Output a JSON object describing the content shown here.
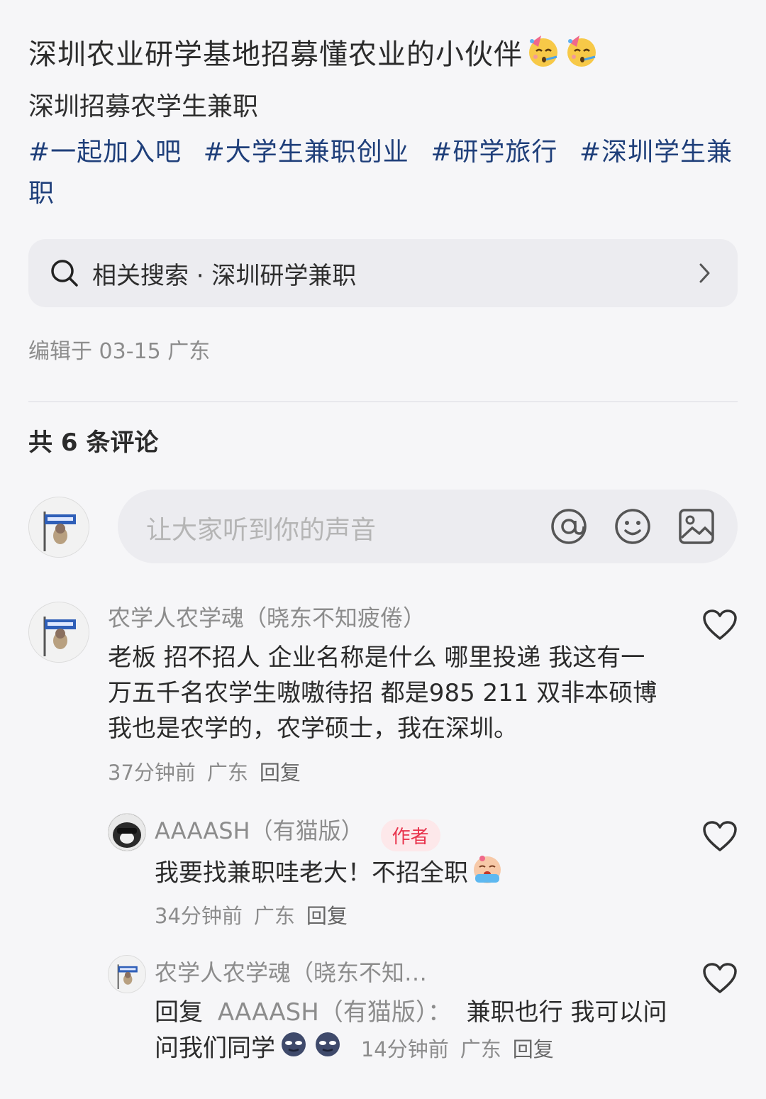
{
  "post": {
    "title": "深圳农业研学基地招募懂农业的小伙伴",
    "subtitle": "深圳招募农学生兼职",
    "tags": [
      "#一起加入吧",
      "#大学生兼职创业",
      "#研学旅行",
      "#深圳学生兼职"
    ],
    "related_search": "相关搜索 · 深圳研学兼职",
    "edited": "编辑于 03-15 广东",
    "title_emoji": "party-face-icon"
  },
  "comments_section": {
    "count_label": "共 6 条评论",
    "input_placeholder": "让大家听到你的声音"
  },
  "comments": [
    {
      "name": "农学人农学魂（晓东不知疲倦）",
      "text": "老板 招不招人 企业名称是什么 哪里投递   我这有一万五千名农学生嗷嗷待招 都是985 211 双非本硕博   我也是农学的，农学硕士，我在深圳。",
      "time": "37分钟前",
      "location": "广东",
      "reply": "回复"
    },
    {
      "name": "AAAASH（有猫版）",
      "badge": "作者",
      "text": "我要找兼职哇老大！不招全职",
      "time": "34分钟前",
      "location": "广东",
      "reply": "回复"
    },
    {
      "name": "农学人农学魂（晓东不知…",
      "reply_prefix": "回复",
      "reply_to": "AAAASH（有猫版）：",
      "text": "兼职也行 我可以问问我们同学",
      "time": "14分钟前",
      "location": "广东",
      "reply": "回复"
    }
  ],
  "colors": {
    "tag_blue": "#1f3f7a",
    "author_badge_bg": "#fde8ea",
    "author_badge_text": "#e8334c",
    "background": "#f6f6f8"
  }
}
